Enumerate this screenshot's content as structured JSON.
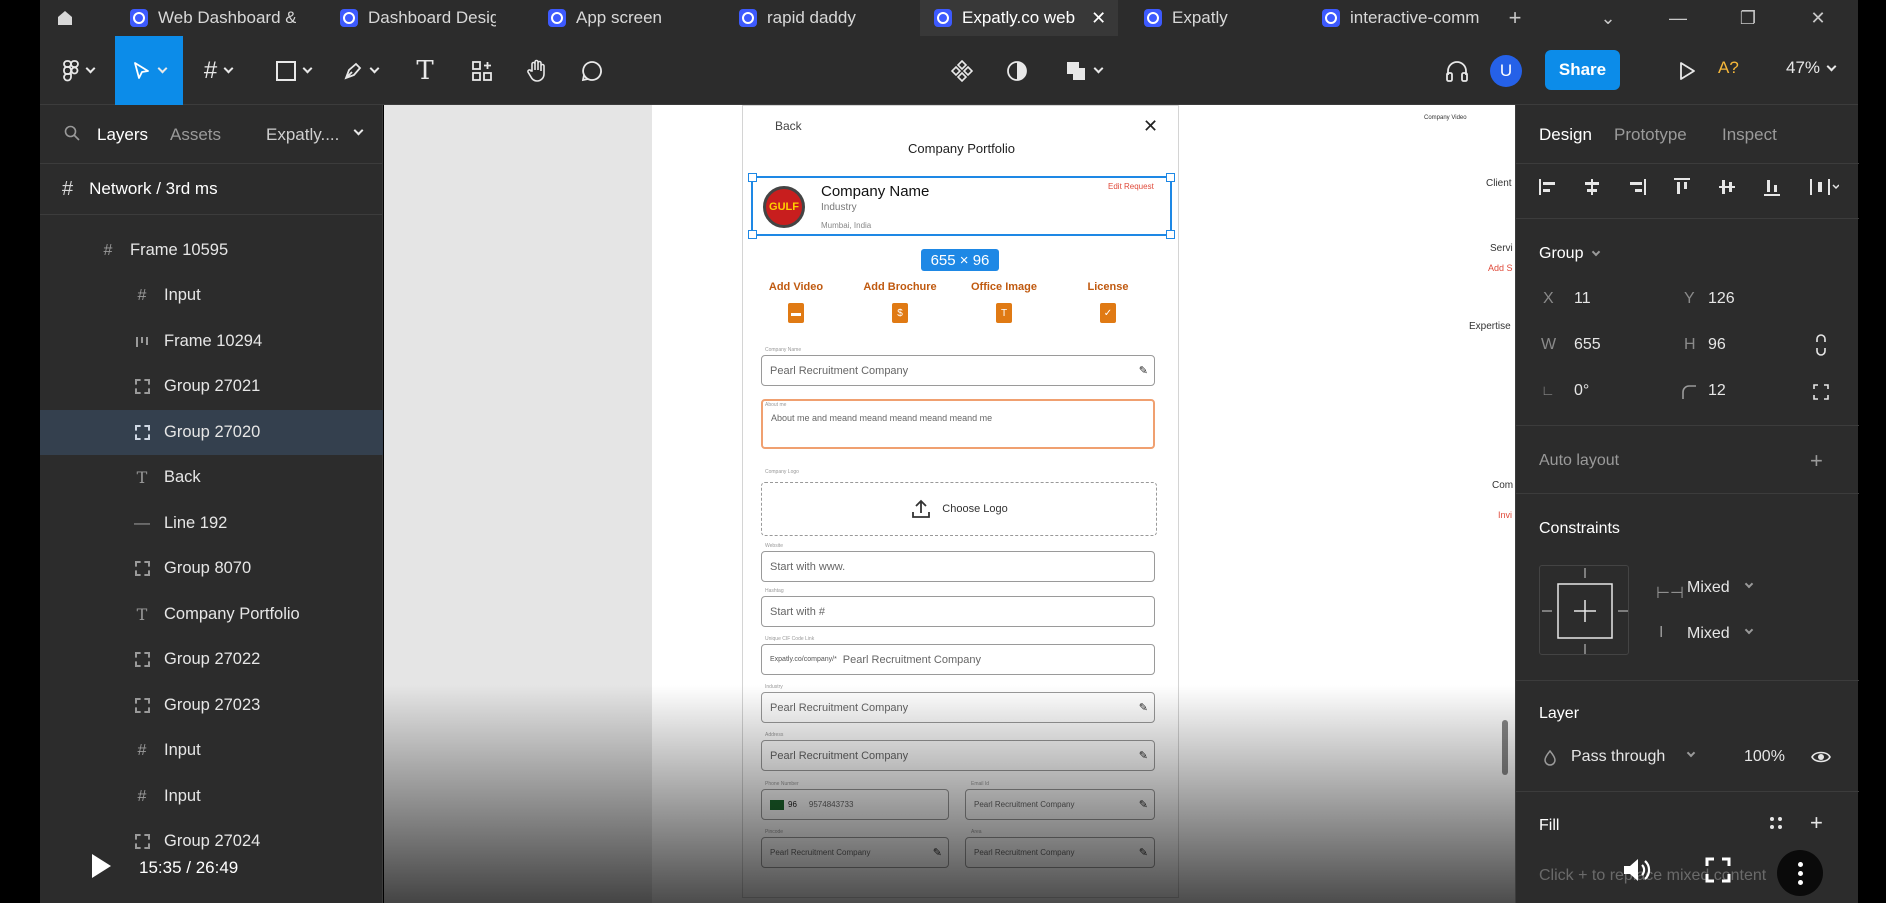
{
  "tabs": [
    {
      "label": "Web Dashboard &",
      "active": false
    },
    {
      "label": "Dashboard Design",
      "active": false
    },
    {
      "label": "App screen",
      "active": false
    },
    {
      "label": "rapid daddy",
      "active": false
    },
    {
      "label": "Expatly.co web",
      "active": true
    },
    {
      "label": "Expatly",
      "active": false
    },
    {
      "label": "interactive-comm",
      "active": false
    }
  ],
  "toolbar": {
    "share_label": "Share",
    "avatar_initial": "U",
    "ai_label": "A?",
    "zoom": "47%"
  },
  "left_panel": {
    "tab_layers": "Layers",
    "tab_assets": "Assets",
    "page_dropdown": "Expatly....",
    "current_page": "Network / 3rd ms",
    "layers": [
      {
        "name": "Frame 10595",
        "icon": "frame-icon",
        "selected": false
      },
      {
        "name": "Input",
        "icon": "frame-icon",
        "selected": false
      },
      {
        "name": "Frame 10294",
        "icon": "auto-layout-icon",
        "selected": false
      },
      {
        "name": "Group 27021",
        "icon": "group-icon",
        "selected": false
      },
      {
        "name": "Group 27020",
        "icon": "group-icon",
        "selected": true
      },
      {
        "name": "Back",
        "icon": "text-icon",
        "selected": false
      },
      {
        "name": "Line 192",
        "icon": "line-icon",
        "selected": false
      },
      {
        "name": "Group 8070",
        "icon": "group-icon",
        "selected": false
      },
      {
        "name": "Company Portfolio",
        "icon": "text-icon",
        "selected": false
      },
      {
        "name": "Group 27022",
        "icon": "group-icon",
        "selected": false
      },
      {
        "name": "Group 27023",
        "icon": "group-icon",
        "selected": false
      },
      {
        "name": "Input",
        "icon": "frame-icon",
        "selected": false
      },
      {
        "name": "Input",
        "icon": "frame-icon",
        "selected": false
      },
      {
        "name": "Group 27024",
        "icon": "group-icon",
        "selected": false
      }
    ]
  },
  "canvas": {
    "mobile": {
      "back": "Back",
      "title": "Company Portfolio",
      "company_name": "Company Name",
      "industry": "Industry",
      "location": "Mumbai, India",
      "edit_request": "Edit Request",
      "logo_text": "GULF",
      "selection_size": "655 × 96",
      "actions": [
        "Add Video",
        "Add Brochure",
        "Office Image",
        "License"
      ],
      "fields": [
        {
          "label": "Company Name",
          "value": "Pearl Recruitment Company"
        },
        {
          "label": "About me",
          "value": "About me and meand meand meand meand meand me"
        },
        {
          "label": "Company Logo",
          "value": "Choose Logo"
        },
        {
          "label": "Website",
          "value": "Start with www."
        },
        {
          "label": "Hashtag",
          "value": "Start with #"
        },
        {
          "label": "Unique CIF Code Link",
          "prefix": "Expatly.co/company/*",
          "value": "Pearl Recruitment Company"
        },
        {
          "label": "Industry",
          "value": "Pearl Recruitment Company"
        },
        {
          "label": "Address",
          "value": "Pearl Recruitment Company"
        },
        {
          "label": "Phone Number",
          "code": "96",
          "value": "9574843733"
        },
        {
          "label": "Email Id",
          "value": "Pearl Recruitment Company"
        },
        {
          "label": "Pincode",
          "value": "Pearl Recruitment Company"
        },
        {
          "label": "Area",
          "value": "Pearl Recruitment Company"
        }
      ]
    },
    "side_labels": [
      "Company Video",
      "Client",
      "Servi",
      "Add S",
      "Expertise",
      "Com",
      "Invi"
    ]
  },
  "right_panel": {
    "tab_design": "Design",
    "tab_prototype": "Prototype",
    "tab_inspect": "Inspect",
    "group_label": "Group",
    "x_label": "X",
    "x": "11",
    "y_label": "Y",
    "y": "126",
    "w_label": "W",
    "w": "655",
    "h_label": "H",
    "h": "96",
    "rotation": "0°",
    "radius": "12",
    "auto_layout": "Auto layout",
    "constraints": "Constraints",
    "constraint_h": "Mixed",
    "constraint_v": "Mixed",
    "layer": "Layer",
    "blend": "Pass through",
    "opacity": "100%",
    "fill": "Fill",
    "fill_hint": "Click + to replace mixed content"
  },
  "video": {
    "time": "15:35 / 26:49"
  },
  "colors": {
    "accent": "#0c8ce9",
    "chrome": "#2c2c2c",
    "orange": "#c05a10"
  }
}
